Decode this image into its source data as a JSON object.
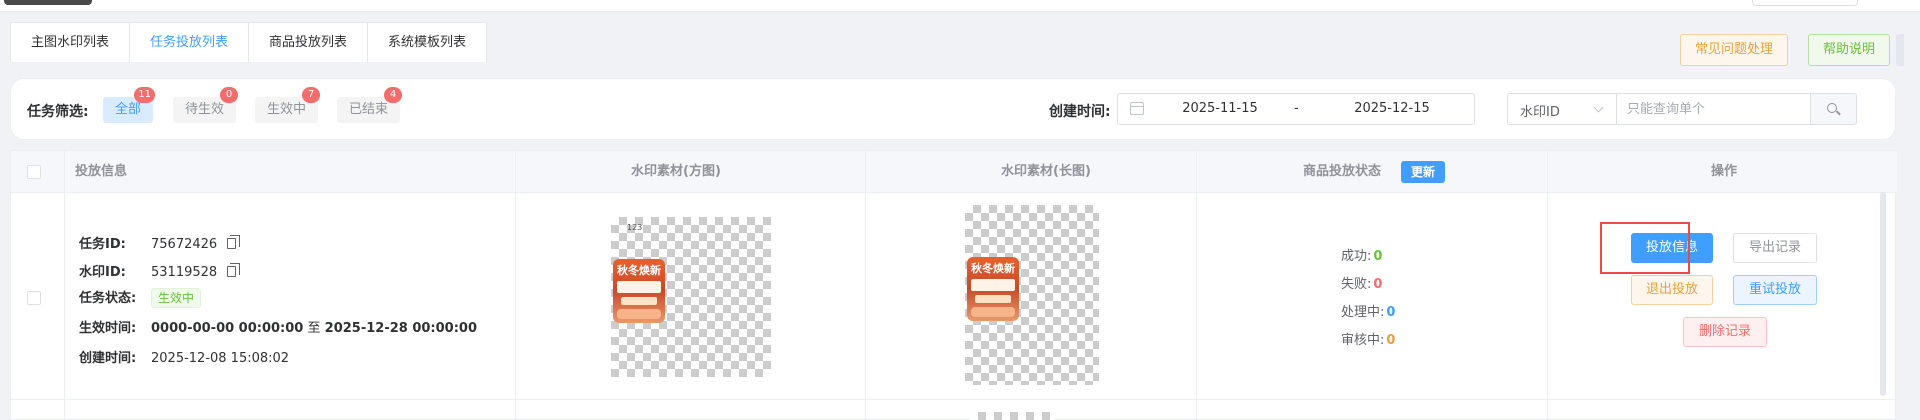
{
  "tabs": [
    {
      "label": "主图水印列表",
      "active": false
    },
    {
      "label": "任务投放列表",
      "active": true
    },
    {
      "label": "商品投放列表",
      "active": false
    },
    {
      "label": "系统模板列表",
      "active": false
    }
  ],
  "header_buttons": {
    "faq": "常见问题处理",
    "help": "帮助说明"
  },
  "filter": {
    "label": "任务筛选:",
    "options": [
      {
        "label": "全部",
        "count": "11",
        "active": true
      },
      {
        "label": "待生效",
        "count": "0",
        "active": false
      },
      {
        "label": "生效中",
        "count": "7",
        "active": false
      },
      {
        "label": "已结束",
        "count": "4",
        "active": false
      }
    ],
    "date_label": "创建时间:",
    "date_start": "2025-11-15",
    "date_sep": "-",
    "date_end": "2025-12-15",
    "select_value": "水印ID",
    "search_placeholder": "只能查询单个"
  },
  "table": {
    "headers": {
      "info": "投放信息",
      "square": "水印素材(方图)",
      "long": "水印素材(长图)",
      "status": "商品投放状态",
      "actions": "操作"
    },
    "refresh_label": "更新",
    "row": {
      "task_id_label": "任务ID:",
      "task_id": "75672426",
      "wm_id_label": "水印ID:",
      "wm_id": "53119528",
      "status_label": "任务状态:",
      "status": "生效中",
      "effective_label": "生效时间:",
      "effective_start": "0000-00-00 00:00:00",
      "effective_to": "至",
      "effective_end": "2025-12-28 00:00:00",
      "created_label": "创建时间:",
      "created": "2025-12-08 15:08:02",
      "wm_text": "秋冬焕新",
      "wm_top_text": "123",
      "stats": {
        "success_label": "成功:",
        "success": "0",
        "fail_label": "失败:",
        "fail": "0",
        "processing_label": "处理中:",
        "processing": "0",
        "review_label": "审核中:",
        "review": "0"
      },
      "actions": {
        "info": "投放信息",
        "export": "导出记录",
        "exit": "退出投放",
        "retry": "重试投放",
        "delete": "删除记录"
      }
    }
  },
  "colors": {
    "primary": "#409eff",
    "success": "#67c23a",
    "warning": "#e6a23c",
    "danger": "#f56c6c",
    "highlight_box": "#f04848"
  }
}
